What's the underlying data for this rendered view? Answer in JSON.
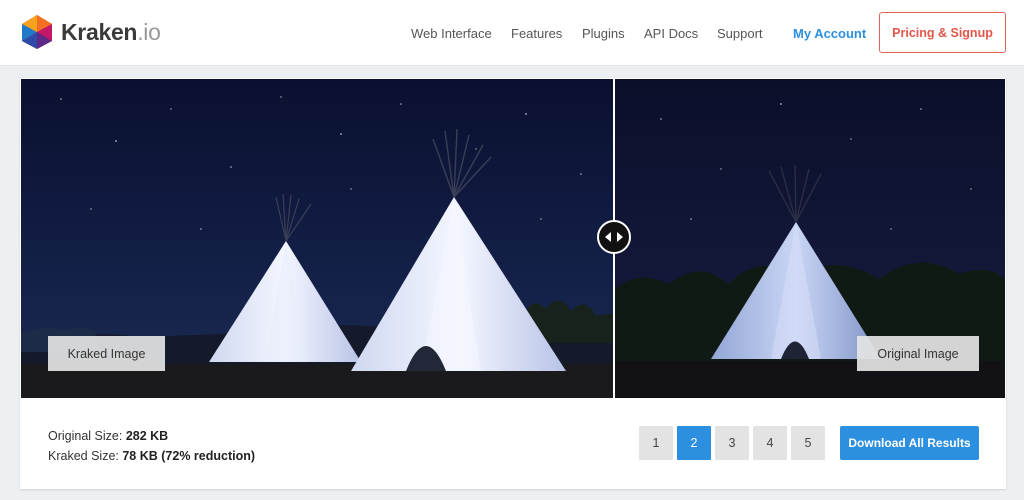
{
  "brand": {
    "name": "Kraken",
    "suffix": ".io"
  },
  "nav": {
    "items": [
      {
        "label": "Web Interface"
      },
      {
        "label": "Features"
      },
      {
        "label": "Plugins"
      },
      {
        "label": "API Docs"
      },
      {
        "label": "Support"
      }
    ],
    "account_label": "My Account",
    "signup_label": "Pricing & Signup"
  },
  "compare": {
    "left_label": "Kraked Image",
    "right_label": "Original Image"
  },
  "stats": {
    "original_label": "Original Size:",
    "original_value": "282 KB",
    "kraked_label": "Kraked Size:",
    "kraked_value": "78 KB (72% reduction)"
  },
  "pagination": {
    "pages": [
      "1",
      "2",
      "3",
      "4",
      "5"
    ],
    "active": "2"
  },
  "actions": {
    "download_label": "Download All Results"
  },
  "colors": {
    "accent": "#2d8fe0",
    "signup_border": "#e4665a",
    "night_sky": "#0d1430"
  }
}
